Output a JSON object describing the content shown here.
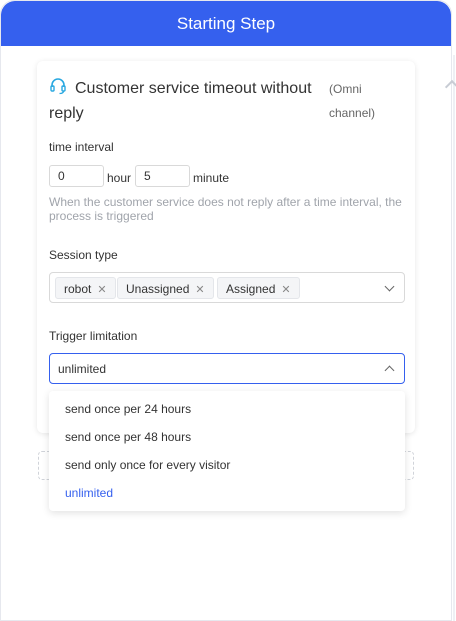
{
  "header": {
    "title": "Starting Step"
  },
  "card": {
    "icon": "headset-icon",
    "title": "Customer service timeout without reply",
    "channel": "(Omni channel)",
    "time_interval": {
      "label": "time interval",
      "hour_value": "0",
      "hour_unit": "hour",
      "minute_value": "5",
      "minute_unit": "minute",
      "hint": "When the customer service does not reply after a time interval, the process is triggered"
    },
    "session_type": {
      "label": "Session type",
      "tags": [
        "robot",
        "Unassigned",
        "Assigned"
      ],
      "remove_glyph": "✕"
    },
    "trigger_limitation": {
      "label": "Trigger limitation",
      "value": "unlimited",
      "options": [
        "send once per 24 hours",
        "send once per 48 hours",
        "send only once for every visitor",
        "unlimited"
      ],
      "selected_index": 3
    }
  },
  "colors": {
    "accent": "#3560ee",
    "icon": "#29a8e0",
    "text": "#333333",
    "hint": "#a0a4ab"
  }
}
